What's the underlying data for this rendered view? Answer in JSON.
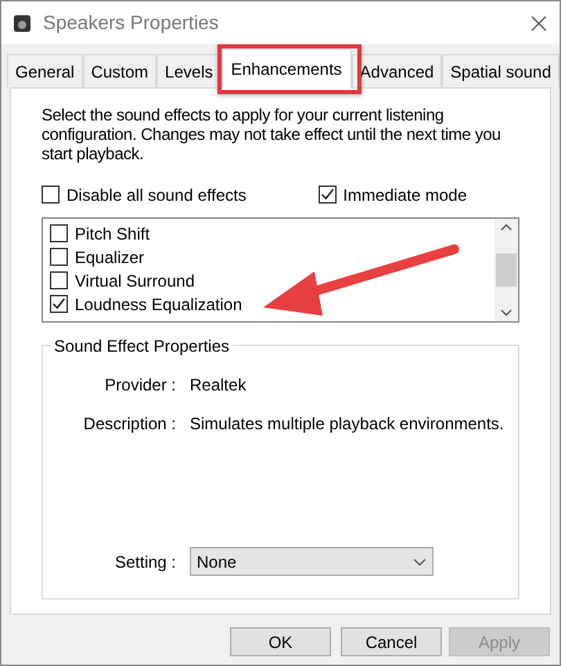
{
  "window": {
    "title": "Speakers Properties"
  },
  "tabs": [
    {
      "label": "General",
      "selected": false
    },
    {
      "label": "Custom",
      "selected": false
    },
    {
      "label": "Levels",
      "selected": false
    },
    {
      "label": "Enhancements",
      "selected": true
    },
    {
      "label": "Advanced",
      "selected": false
    },
    {
      "label": "Spatial sound",
      "selected": false
    }
  ],
  "instructions": "Select the sound effects to apply for your current listening configuration. Changes may not take effect until the next time you start playback.",
  "options": [
    {
      "label": "Disable all sound effects",
      "checked": false
    },
    {
      "label": "Immediate mode",
      "checked": true
    }
  ],
  "effects": [
    {
      "label": "Pitch Shift",
      "checked": false
    },
    {
      "label": "Equalizer",
      "checked": false
    },
    {
      "label": "Virtual Surround",
      "checked": false
    },
    {
      "label": "Loudness Equalization",
      "checked": true
    }
  ],
  "properties": {
    "title": "Sound Effect Properties",
    "rows": [
      {
        "label": "Provider :",
        "value": "Realtek"
      },
      {
        "label": "Description :",
        "value": "Simulates multiple playback environments."
      }
    ],
    "setting": {
      "label": "Setting :",
      "value": "None"
    }
  },
  "buttons": [
    {
      "label": "OK",
      "disabled": false
    },
    {
      "label": "Cancel",
      "disabled": false
    },
    {
      "label": "Apply",
      "disabled": true
    }
  ]
}
